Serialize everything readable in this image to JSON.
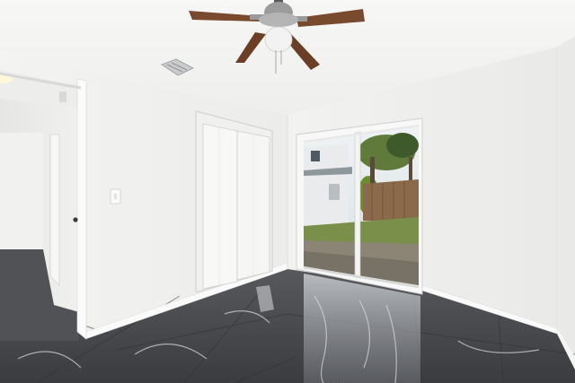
{
  "scene": {
    "kind": "photograph",
    "subject": "empty bedroom",
    "colors": {
      "wall": "#f4f4f2",
      "ceiling": "#f6f6f4",
      "floor": "#4a4c50",
      "trim": "#fafafa",
      "fan_blade": "#7a4a2e",
      "sky": "#dfe8ee",
      "grass": "#7a8f4a",
      "fence": "#8a6a4a"
    },
    "elements": [
      "ceiling-fan",
      "air-vent",
      "open-doorway",
      "bifold-closet-doors",
      "light-switch",
      "sliding-glass-door",
      "marble-tile-floor",
      "baseboard"
    ]
  }
}
